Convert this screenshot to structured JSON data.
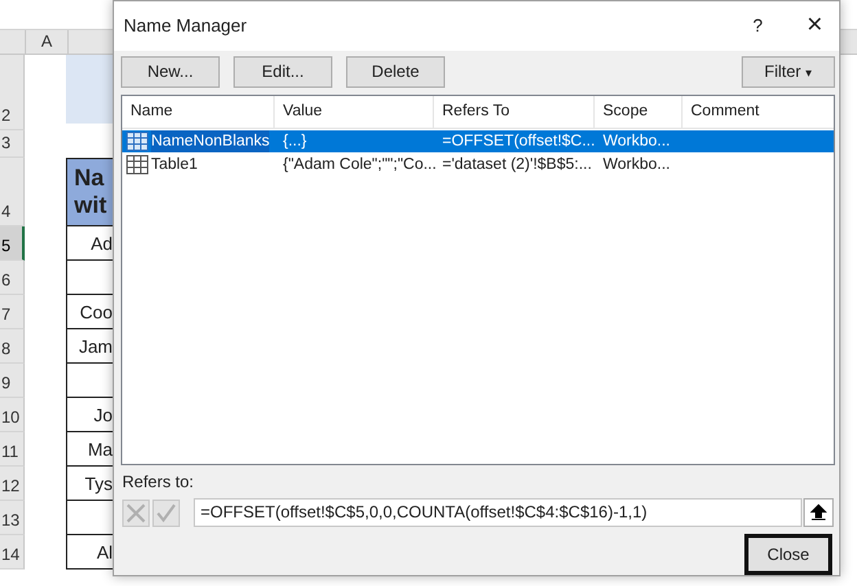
{
  "sheet": {
    "column_header": "A",
    "rows": [
      {
        "number": "2",
        "kind": "title",
        "selected": false
      },
      {
        "number": "3",
        "kind": "spacer",
        "selected": false
      },
      {
        "number": "4",
        "kind": "header",
        "lines": [
          "Na",
          "wit"
        ],
        "selected": false
      },
      {
        "number": "5",
        "kind": "data",
        "cell": "Ad",
        "selected": true
      },
      {
        "number": "6",
        "kind": "data",
        "cell": "",
        "selected": false
      },
      {
        "number": "7",
        "kind": "data",
        "cell": "Coo",
        "selected": false
      },
      {
        "number": "8",
        "kind": "data",
        "cell": "Jam",
        "selected": false
      },
      {
        "number": "9",
        "kind": "data",
        "cell": "",
        "selected": false
      },
      {
        "number": "10",
        "kind": "data",
        "cell": "Jo",
        "selected": false
      },
      {
        "number": "11",
        "kind": "data",
        "cell": "Ma",
        "selected": false
      },
      {
        "number": "12",
        "kind": "data",
        "cell": "Tys",
        "selected": false
      },
      {
        "number": "13",
        "kind": "data",
        "cell": "",
        "selected": false
      },
      {
        "number": "14",
        "kind": "data",
        "cell": "Al",
        "selected": false
      }
    ]
  },
  "dialog": {
    "title": "Name Manager",
    "help": "?",
    "close_glyph": "×",
    "buttons": [
      "New...",
      "Edit...",
      "Delete"
    ],
    "filter_button": "Filter",
    "filter_caret": "▾",
    "columns": [
      "Name",
      "Value",
      "Refers To",
      "Scope",
      "Comment"
    ],
    "names": [
      {
        "name": "NameNonBlanks",
        "value": "{...}",
        "refers_to": "=OFFSET(offset!$C...",
        "scope": "Workbo...",
        "selected": true
      },
      {
        "name": "Table1",
        "value": "{\"Adam Cole\";\"\";\"Co...",
        "refers_to": "='dataset (2)'!$B$5:...",
        "scope": "Workbo...",
        "selected": false
      }
    ],
    "refers_to_label": "Refers to:",
    "refers_to_value": "=OFFSET(offset!$C$5,0,0,COUNTA(offset!$C$4:$C$16)-1,1)",
    "close_button": "Close"
  }
}
